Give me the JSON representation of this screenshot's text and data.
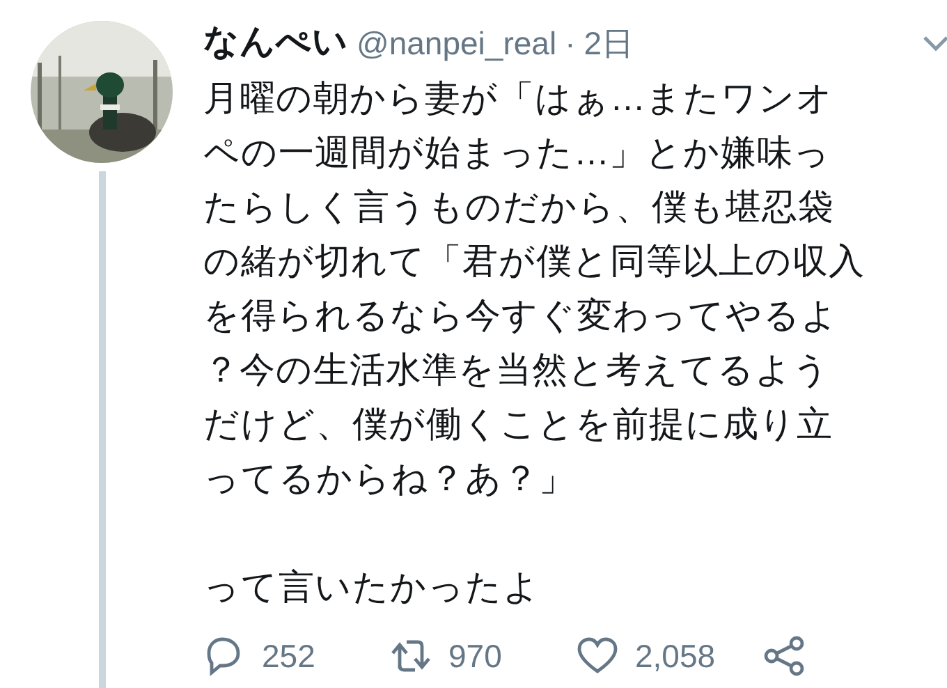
{
  "tweet": {
    "display_name": "なんぺい",
    "handle": "@nanpei_real",
    "separator": "·",
    "time": "2日",
    "paragraphs": [
      "月曜の朝から妻が「はぁ…またワンオペの一週間が始まった…」とか嫌味ったらしく言うものだから、僕も堪忍袋の緒が切れて「君が僕と同等以上の収入を得られるなら今すぐ変わってやるよ？今の生活水準を当然と考えてるようだけど、僕が働くことを前提に成り立ってるからね？あ？」",
      "って言いたかったよ"
    ],
    "actions": [
      {
        "kind": "reply",
        "count": "252"
      },
      {
        "kind": "retweet",
        "count": "970"
      },
      {
        "kind": "like",
        "count": "2,058"
      },
      {
        "kind": "share"
      }
    ]
  }
}
